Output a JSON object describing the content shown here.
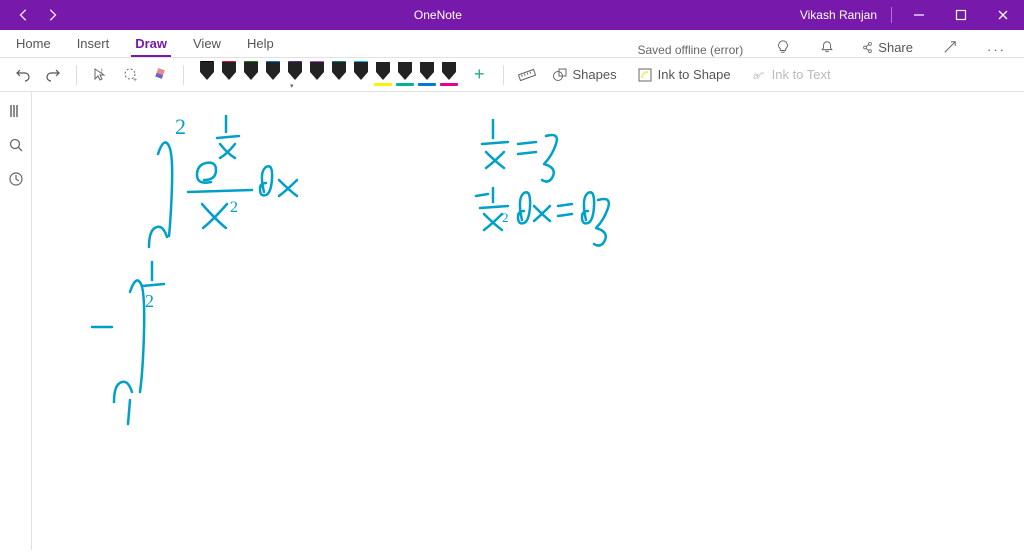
{
  "titlebar": {
    "app_name": "OneNote",
    "user_name": "Vikash Ranjan"
  },
  "tabs": {
    "home": "Home",
    "insert": "Insert",
    "draw": "Draw",
    "view": "View",
    "help": "Help",
    "status": "Saved offline (error)",
    "share_label": "Share"
  },
  "ribbon": {
    "shapes_label": "Shapes",
    "ink_to_shape": "Ink to Shape",
    "ink_to_text": "Ink to Text",
    "pen_caps": [
      "#000000",
      "#e81123",
      "#107c10",
      "#0078d7",
      "#5c2d91",
      "#b146c2",
      "#008272",
      "#00bcf2"
    ],
    "highlighter_bars": [
      "#fff100",
      "#00b294",
      "#0078d7",
      "#e3008c"
    ]
  }
}
